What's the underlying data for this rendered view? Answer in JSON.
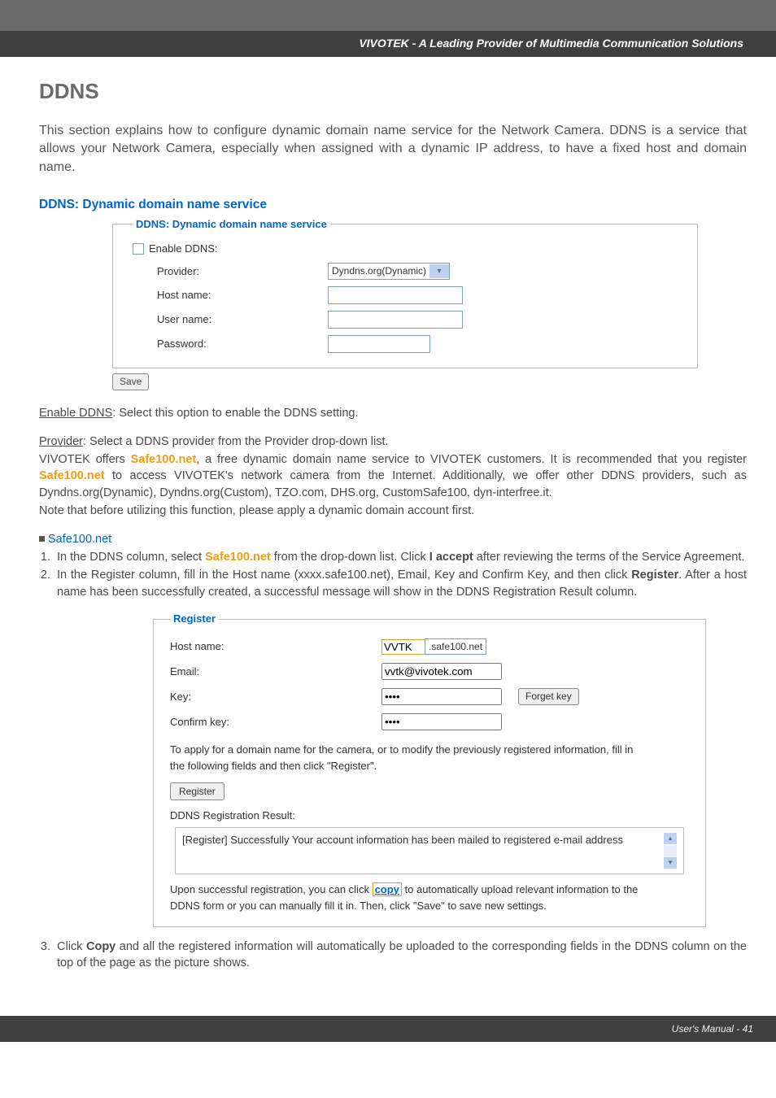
{
  "header": {
    "brand": "VIVOTEK - A Leading Provider of Multimedia Communication Solutions"
  },
  "page": {
    "title": "DDNS",
    "intro": "This section explains how to configure dynamic domain name service for the Network Camera. DDNS is a service that allows your Network Camera, especially when assigned with a dynamic IP address, to have a fixed host and domain name."
  },
  "ddns_section": {
    "heading": "DDNS: Dynamic domain name service",
    "legend": "DDNS: Dynamic domain name service",
    "enable_label": "Enable DDNS:",
    "rows": {
      "provider_label": "Provider:",
      "provider_value": "Dyndns.org(Dynamic)",
      "hostname_label": "Host name:",
      "username_label": "User name:",
      "password_label": "Password:"
    },
    "save_label": "Save"
  },
  "enable_line": {
    "title": "Enable DDNS",
    "text": ": Select this option to enable the DDNS setting."
  },
  "provider_block": {
    "title": "Provider",
    "after_title": ": Select a DDNS provider from the Provider drop-down list.",
    "l1a": "VIVOTEK offers ",
    "safe1": "Safe100.net",
    "l1b": ", a free dynamic domain name service to VIVOTEK customers. It is recommended that you register ",
    "safe2": "Safe100.net",
    "l1c": " to access VIVOTEK's network camera from the Internet. Additionally, we offer other DDNS providers, such as Dyndns.org(Dynamic), Dyndns.org(Custom), TZO.com, DHS.org, CustomSafe100, dyn-interfree.it.",
    "note": "Note that before utilizing this function, please apply a dynamic domain account first."
  },
  "safe_bullet": "Safe100.net",
  "steps": {
    "s1a": "In the DDNS column, select ",
    "s1_link": "Safe100.net",
    "s1b": " from the drop-down list. Click ",
    "s1_bold": "I accept",
    "s1c": " after reviewing the terms of the Service Agreement.",
    "s2a": "In the Register column, fill in the Host name (xxxx.safe100.net), Email, Key and Confirm Key, and then click ",
    "s2_bold": "Register",
    "s2b": ". After a host name has been successfully created, a successful message will show in the DDNS Registration Result column."
  },
  "register_box": {
    "legend": "Register",
    "hostname_label": "Host name:",
    "hostname_prefix": "VVTK",
    "hostname_suffix": ".safe100.net",
    "email_label": "Email:",
    "email_value": "vvtk@vivotek.com",
    "key_label": "Key:",
    "key_value": "••••",
    "forget_label": "Forget key",
    "confirm_label": "Confirm key:",
    "confirm_value": "••••",
    "para1": "To apply for a domain name for the camera, or to modify the previously registered information, fill in",
    "para2": "the following fields and then click \"Register\".",
    "register_btn": "Register",
    "result_label": "DDNS Registration Result:",
    "result_text": "[Register] Successfully Your account information has been mailed to registered e-mail address",
    "upon1": "Upon successful registration, you can click ",
    "copy_link": "copy",
    "upon2": " to automatically upload relevant information to the",
    "upon3": "DDNS form or you can manually fill it in. Then, click \"Save\" to save new settings."
  },
  "step3": {
    "a": "Click ",
    "bold": "Copy",
    "b": " and all the registered information will automatically be uploaded to the corresponding fields in the DDNS column on the top of the page as the picture shows."
  },
  "footer": {
    "text": "User's Manual - 41"
  }
}
